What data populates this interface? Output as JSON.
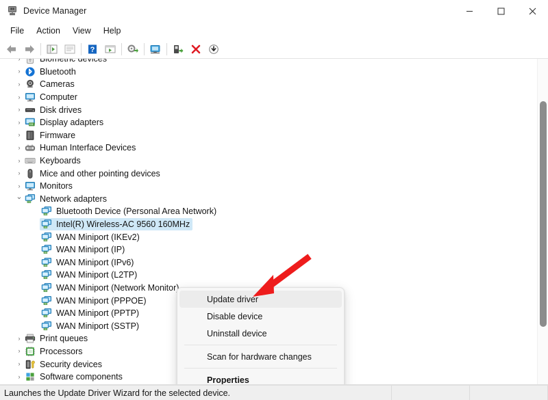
{
  "window": {
    "title": "Device Manager",
    "icon": "device-manager-icon",
    "controls": {
      "minimize": "—",
      "maximize": "□",
      "close": "✕"
    }
  },
  "menubar": {
    "items": [
      {
        "label": "File"
      },
      {
        "label": "Action"
      },
      {
        "label": "View"
      },
      {
        "label": "Help"
      }
    ]
  },
  "toolbar": {
    "buttons": [
      {
        "name": "back-arrow-icon"
      },
      {
        "name": "forward-arrow-icon"
      },
      {
        "name": "show-hide-console-tree-icon"
      },
      {
        "name": "properties-icon"
      },
      {
        "name": "help-icon"
      },
      {
        "name": "show-hide-action-pane-icon"
      },
      {
        "name": "update-driver-icon"
      },
      {
        "name": "scan-for-hardware-changes-icon"
      },
      {
        "name": "enable-device-icon"
      },
      {
        "name": "uninstall-device-icon"
      },
      {
        "name": "download-icon"
      }
    ]
  },
  "tree": {
    "items": [
      {
        "label": "Biometric devices",
        "level": 1,
        "expander": "collapsed",
        "icon": "biometric-icon",
        "selected": false
      },
      {
        "label": "Bluetooth",
        "level": 1,
        "expander": "collapsed",
        "icon": "bluetooth-icon",
        "selected": false
      },
      {
        "label": "Cameras",
        "level": 1,
        "expander": "collapsed",
        "icon": "camera-icon",
        "selected": false
      },
      {
        "label": "Computer",
        "level": 1,
        "expander": "collapsed",
        "icon": "computer-icon",
        "selected": false
      },
      {
        "label": "Disk drives",
        "level": 1,
        "expander": "collapsed",
        "icon": "disk-drive-icon",
        "selected": false
      },
      {
        "label": "Display adapters",
        "level": 1,
        "expander": "collapsed",
        "icon": "display-adapter-icon",
        "selected": false
      },
      {
        "label": "Firmware",
        "level": 1,
        "expander": "collapsed",
        "icon": "firmware-icon",
        "selected": false
      },
      {
        "label": "Human Interface Devices",
        "level": 1,
        "expander": "collapsed",
        "icon": "hid-icon",
        "selected": false
      },
      {
        "label": "Keyboards",
        "level": 1,
        "expander": "collapsed",
        "icon": "keyboard-icon",
        "selected": false
      },
      {
        "label": "Mice and other pointing devices",
        "level": 1,
        "expander": "collapsed",
        "icon": "mouse-icon",
        "selected": false
      },
      {
        "label": "Monitors",
        "level": 1,
        "expander": "collapsed",
        "icon": "monitor-icon",
        "selected": false
      },
      {
        "label": "Network adapters",
        "level": 1,
        "expander": "expanded",
        "icon": "network-adapter-icon",
        "selected": false
      },
      {
        "label": "Bluetooth Device (Personal Area Network)",
        "level": 2,
        "expander": "none",
        "icon": "network-adapter-icon",
        "selected": false
      },
      {
        "label": "Intel(R) Wireless-AC 9560 160MHz",
        "level": 2,
        "expander": "none",
        "icon": "network-adapter-icon",
        "selected": true
      },
      {
        "label": "WAN Miniport (IKEv2)",
        "level": 2,
        "expander": "none",
        "icon": "network-adapter-icon",
        "selected": false
      },
      {
        "label": "WAN Miniport (IP)",
        "level": 2,
        "expander": "none",
        "icon": "network-adapter-icon",
        "selected": false
      },
      {
        "label": "WAN Miniport (IPv6)",
        "level": 2,
        "expander": "none",
        "icon": "network-adapter-icon",
        "selected": false
      },
      {
        "label": "WAN Miniport (L2TP)",
        "level": 2,
        "expander": "none",
        "icon": "network-adapter-icon",
        "selected": false
      },
      {
        "label": "WAN Miniport (Network Monitor)",
        "level": 2,
        "expander": "none",
        "icon": "network-adapter-icon",
        "selected": false
      },
      {
        "label": "WAN Miniport (PPPOE)",
        "level": 2,
        "expander": "none",
        "icon": "network-adapter-icon",
        "selected": false
      },
      {
        "label": "WAN Miniport (PPTP)",
        "level": 2,
        "expander": "none",
        "icon": "network-adapter-icon",
        "selected": false
      },
      {
        "label": "WAN Miniport (SSTP)",
        "level": 2,
        "expander": "none",
        "icon": "network-adapter-icon",
        "selected": false
      },
      {
        "label": "Print queues",
        "level": 1,
        "expander": "collapsed",
        "icon": "printer-icon",
        "selected": false
      },
      {
        "label": "Processors",
        "level": 1,
        "expander": "collapsed",
        "icon": "processor-icon",
        "selected": false
      },
      {
        "label": "Security devices",
        "level": 1,
        "expander": "collapsed",
        "icon": "security-device-icon",
        "selected": false
      },
      {
        "label": "Software components",
        "level": 1,
        "expander": "collapsed",
        "icon": "software-component-icon",
        "selected": false
      }
    ]
  },
  "context_menu": {
    "items": [
      {
        "label": "Update driver",
        "highlight": true,
        "bold": false
      },
      {
        "label": "Disable device",
        "highlight": false,
        "bold": false
      },
      {
        "label": "Uninstall device",
        "highlight": false,
        "bold": false
      },
      {
        "separator": true
      },
      {
        "label": "Scan for hardware changes",
        "highlight": false,
        "bold": false
      },
      {
        "separator": true
      },
      {
        "label": "Properties",
        "highlight": false,
        "bold": true
      }
    ]
  },
  "annotation": {
    "arrow": "red-arrow-pointer",
    "color": "#EE1C1C"
  },
  "statusbar": {
    "text": "Launches the Update Driver Wizard for the selected device."
  }
}
